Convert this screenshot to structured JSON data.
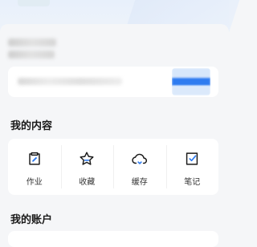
{
  "colors": {
    "accent": "#2f7cf0",
    "background": "#f5f6f8",
    "card": "#ffffff"
  },
  "my_content": {
    "title": "我的内容",
    "items": [
      {
        "label": "作业",
        "icon": "homework-icon"
      },
      {
        "label": "收藏",
        "icon": "star-icon"
      },
      {
        "label": "缓存",
        "icon": "cloud-download-icon"
      },
      {
        "label": "笔记",
        "icon": "note-check-icon"
      }
    ]
  },
  "my_account": {
    "title": "我的账户"
  }
}
